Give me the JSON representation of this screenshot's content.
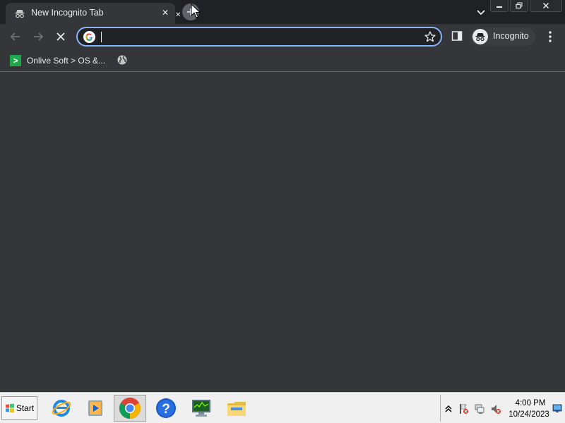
{
  "browser": {
    "tab": {
      "title": "New Incognito Tab",
      "icon": "incognito-icon",
      "close_label": "✕",
      "second_close_label": "✕"
    },
    "new_tab_icon": "plus-icon",
    "tab_search_icon": "chevron-down-icon",
    "window_controls": [
      "minimize-icon",
      "restore-icon",
      "close-icon"
    ],
    "toolbar": {
      "back_icon": "arrow-left-icon",
      "forward_icon": "arrow-right-icon",
      "stop_icon": "stop-loading-icon",
      "omnibox": {
        "value": "",
        "placeholder": "",
        "search_engine_icon": "google-icon"
      },
      "bookmark_star_icon": "star-icon",
      "side_panel_icon": "side-panel-icon",
      "profile_label": "Incognito",
      "menu_icon": "three-dots-icon"
    },
    "bookmarks": [
      {
        "label": "Onlive Soft > OS &...",
        "icon": "onlive-soft-icon",
        "icon_glyph": ">"
      },
      {
        "label": "",
        "icon": "globe-icon"
      }
    ],
    "colors": {
      "frame": "#202124",
      "toolbar": "#35363a",
      "omnibox_focus": "#8ab4f8",
      "text": "#e8eaed"
    }
  },
  "taskbar": {
    "start_label": "Start",
    "apps": [
      "internet-explorer-icon",
      "media-player-icon",
      "chrome-icon",
      "help-icon",
      "system-monitor-icon",
      "file-explorer-icon"
    ],
    "active_app": "chrome-icon",
    "tray_icons": [
      "show-hidden-icons-icon",
      "action-center-icon",
      "network-icon",
      "volume-muted-icon"
    ],
    "clock": {
      "time": "4:00 PM",
      "date": "10/24/2023"
    }
  }
}
